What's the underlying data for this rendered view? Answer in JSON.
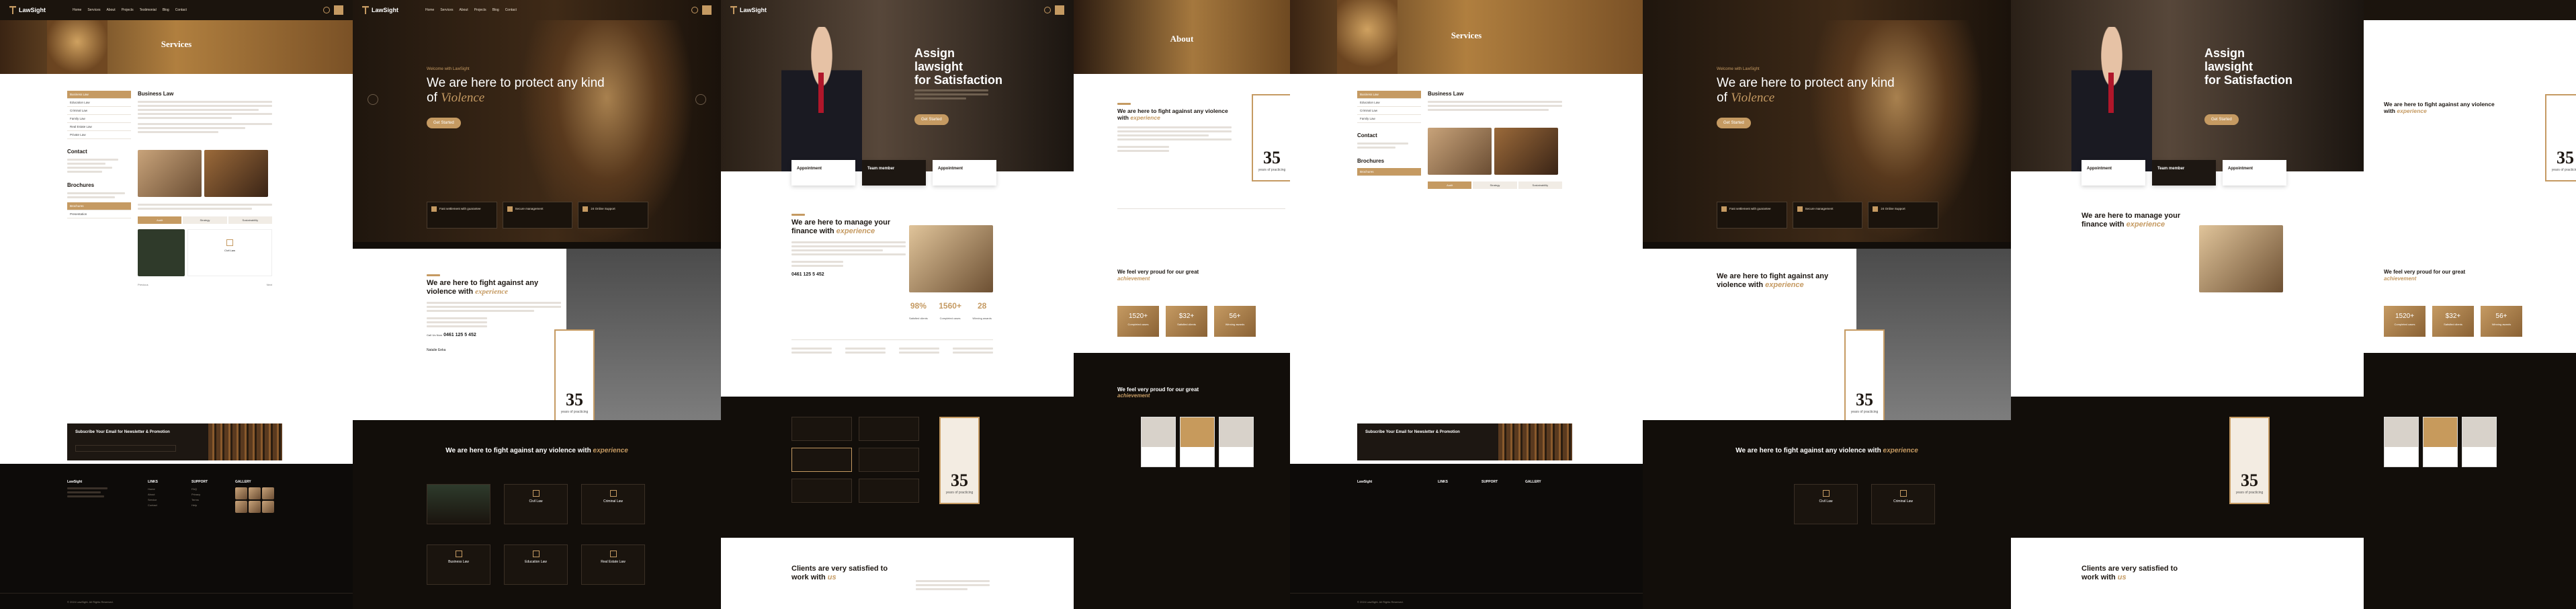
{
  "brand": {
    "name": "LawSight",
    "gold": "#c59a62",
    "dark": "#1b140d"
  },
  "nav": {
    "items": [
      "Home",
      "Services",
      "About",
      "Projects",
      "Testimonial",
      "Blog",
      "Contact"
    ]
  },
  "services_page": {
    "banner_title": "Services",
    "sidebar": [
      "Business Law",
      "Education Law",
      "Criminal Law",
      "Family Law",
      "Real Estate Law",
      "Private Law"
    ],
    "contact_title": "Contact",
    "brochures_title": "Brochures",
    "brochure_buttons": [
      "Brochures",
      "Presentation"
    ],
    "main_title": "Business Law",
    "tabs": [
      "Audit",
      "Strategy",
      "Sustainability"
    ],
    "card_label": "Civil Law",
    "prev_label": "Previous",
    "next_label": "Next"
  },
  "subscribe": {
    "title": "Subscribe Your Email for Newsletter & Promotion"
  },
  "footer": {
    "cols": [
      {
        "title": "LINKS",
        "items": [
          "Home",
          "About",
          "Service",
          "Contact",
          "Blog"
        ]
      },
      {
        "title": "SUPPORT",
        "items": [
          "FAQ",
          "Privacy",
          "Terms",
          "Help",
          "Policy"
        ]
      },
      {
        "title": "GALLERY",
        "items": []
      }
    ],
    "copyright": "© 2024 LawSight. All Rights Reserved."
  },
  "home1": {
    "kicker": "Welcome with LawSight",
    "title": "We are here to protect any kind of",
    "title_em": "Violence",
    "button": "Get Started",
    "features": [
      "Fast settlement with guarantee",
      "Secure management",
      "24 Online Support"
    ],
    "about_title": "We are here to fight against any violence with",
    "about_em": "experience",
    "years": "35",
    "years_label": "years of practicing",
    "phone_label": "Call Us Now",
    "phone": "0461 125 5 452",
    "signature_name": "Natalie Eeka",
    "fight_title": "We are here to fight against any violence with",
    "fight_em": "experience",
    "practice_cards": [
      "Civil Law",
      "Criminal Law",
      "Business Law",
      "Education Law",
      "Real Estate Law"
    ]
  },
  "home2": {
    "title_line1": "Assign",
    "title_line2": "lawsight",
    "title_line3": "for Satisfaction",
    "button": "Get Started",
    "appointments": [
      "Appointment",
      "Team member",
      "Appointment"
    ],
    "manage_title": "We are here to manage your finance with",
    "manage_em": "experience",
    "stats": [
      {
        "value": "98%",
        "label": "Satisfied clients"
      },
      {
        "value": "1560+",
        "label": "Completed cases"
      },
      {
        "value": "28",
        "label": "Winning awards"
      }
    ],
    "phone": "0461 125 5 452",
    "years": "35",
    "years_label": "years of practicing",
    "clients_title": "Clients are very satisfied to work with",
    "clients_em": "us"
  },
  "about_page": {
    "banner_title": "About",
    "title": "We are here to fight against any violence with",
    "title_em": "experience",
    "years": "35",
    "years_label": "years of practicing",
    "proud_title": "We feel very proud for our great",
    "proud_em": "achievement",
    "tiles": [
      {
        "value": "1520+",
        "label": "Completed cases"
      },
      {
        "value": "$32+",
        "label": "Satisfied clients"
      },
      {
        "value": "56+",
        "label": "Winning awards"
      }
    ]
  }
}
